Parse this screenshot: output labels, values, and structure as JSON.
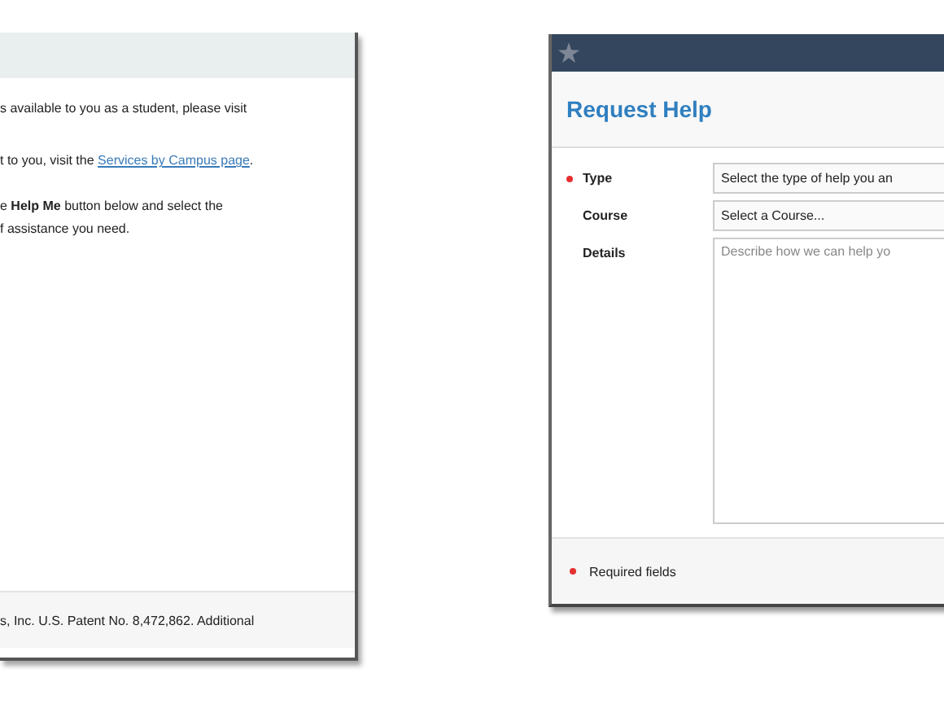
{
  "help_panel": {
    "paragraphs": [
      {
        "lines": [
          {
            "segments": [
              {
                "kind": "text",
                "text": "s available to you as a student, please visit"
              }
            ]
          }
        ]
      },
      {
        "lines": [
          {
            "segments": [
              {
                "kind": "text",
                "text": "t to you, visit the "
              },
              {
                "kind": "link",
                "text": "Services by Campus page"
              },
              {
                "kind": "text",
                "text": "."
              }
            ]
          }
        ]
      },
      {
        "lines": [
          {
            "segments": [
              {
                "kind": "text",
                "text": "e **Help Me** button below and select the"
              }
            ]
          },
          {
            "segments": [
              {
                "kind": "text",
                "text": "f assistance you need."
              }
            ]
          }
        ]
      }
    ],
    "footer": "s, Inc. U.S. Patent No. 8,472,862. Additional"
  },
  "request_dialog": {
    "title": "Request Help",
    "fields": [
      {
        "label": "Type",
        "required": true,
        "kind": "select",
        "placeholder": "Select the type of help you an"
      },
      {
        "label": "Course",
        "required": false,
        "kind": "select",
        "placeholder": "Select a Course..."
      },
      {
        "label": "Details",
        "required": false,
        "kind": "textarea",
        "placeholder": "Describe how we can help yo"
      }
    ],
    "footer_note": "Required fields"
  }
}
